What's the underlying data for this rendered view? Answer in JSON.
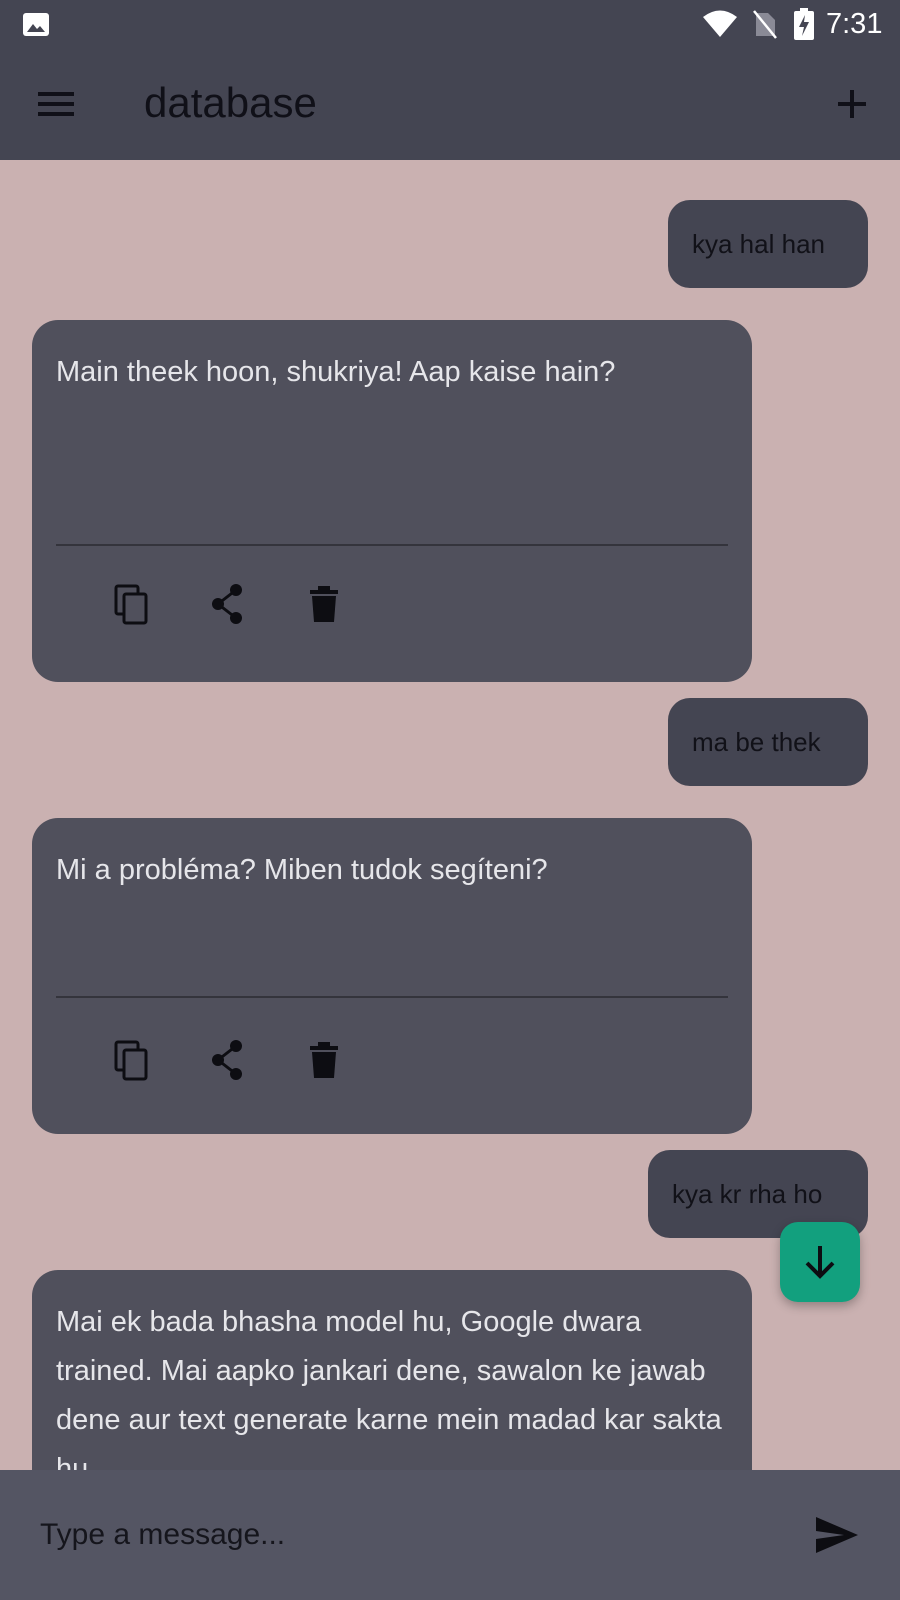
{
  "status_bar": {
    "time": "7:31",
    "icons": [
      "gallery-icon",
      "wifi-icon",
      "no-sim-icon",
      "battery-charging-icon"
    ]
  },
  "app_bar": {
    "title": "database",
    "menu_icon": "hamburger-menu-icon",
    "add_icon": "plus-icon"
  },
  "messages": [
    {
      "role": "user",
      "text": "kya hal han"
    },
    {
      "role": "bot",
      "text": "Main theek hoon, shukriya! Aap kaise hain?",
      "actions": [
        "copy-icon",
        "share-icon",
        "delete-icon"
      ]
    },
    {
      "role": "user",
      "text": "ma be thek"
    },
    {
      "role": "bot",
      "text": "Mi a probléma? Miben tudok segíteni?",
      "actions": [
        "copy-icon",
        "share-icon",
        "delete-icon"
      ]
    },
    {
      "role": "user",
      "text": "kya kr rha ho"
    },
    {
      "role": "bot",
      "text": "Mai ek bada bhasha model hu, Google dwara trained. Mai aapko jankari dene, sawalon ke jawab dene aur text generate karne mein madad kar sakta hu."
    }
  ],
  "scroll_down_icon": "arrow-down-icon",
  "composer": {
    "placeholder": "Type a message...",
    "send_icon": "send-icon"
  },
  "colors": {
    "background": "#cab1b1",
    "app_bar": "#444552",
    "bot_bubble": "#50505c",
    "user_bubble": "#444552",
    "fab": "#12a07e",
    "input_bar": "#545563"
  }
}
